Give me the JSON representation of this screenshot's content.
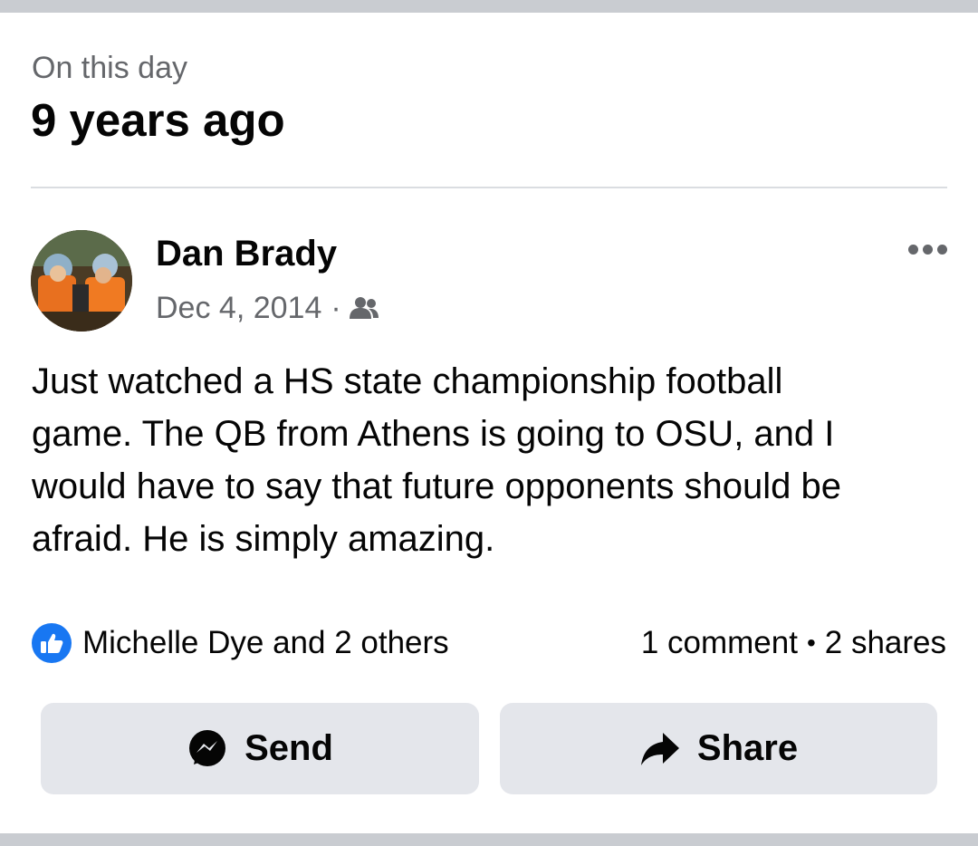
{
  "header": {
    "kicker": "On this day",
    "title": "9 years ago"
  },
  "post": {
    "author": "Dan Brady",
    "date": "Dec 4, 2014",
    "separator": "·",
    "audience_icon": "friends-icon",
    "more_icon": "more-options-icon",
    "text": "Just watched a HS state championship football\ngame. The QB from Athens is going to OSU, and I\nwould have to say that future opponents should be\nafraid. He is simply amazing.",
    "reactions": {
      "icon": "like-icon",
      "label": "Michelle Dye and 2 others"
    },
    "counts": {
      "comments": "1 comment",
      "separator": "•",
      "shares": "2 shares"
    }
  },
  "actions": {
    "send_label": "Send",
    "send_icon": "messenger-icon",
    "share_label": "Share",
    "share_icon": "share-arrow-icon"
  },
  "colors": {
    "accent": "#1877f2",
    "button_bg": "#e4e6eb",
    "secondary_text": "#65676b",
    "bar_gray": "#c9ccd1"
  }
}
